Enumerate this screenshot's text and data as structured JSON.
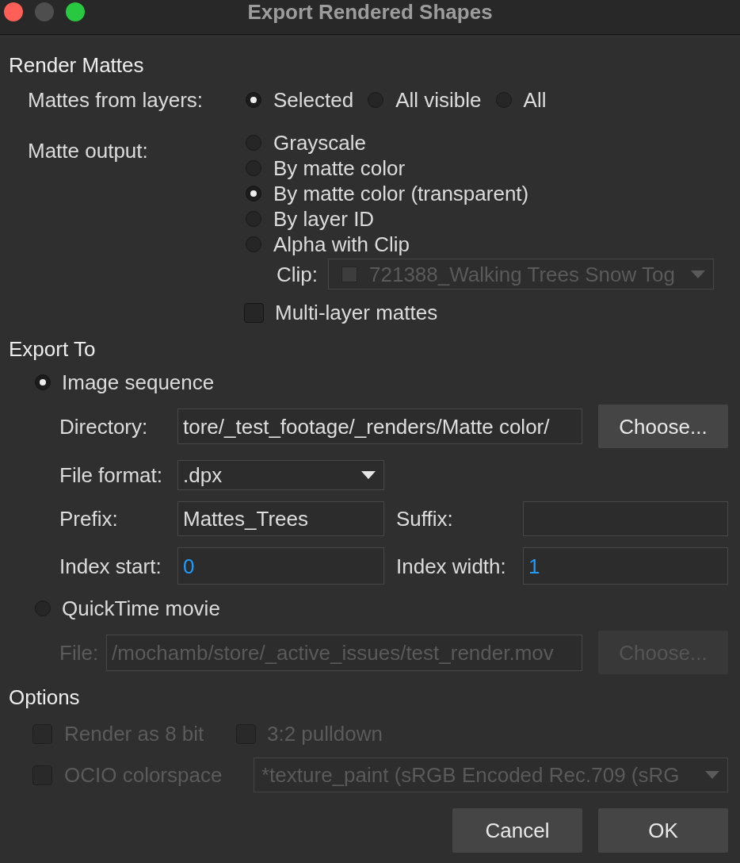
{
  "window": {
    "title": "Export Rendered Shapes",
    "controls": [
      {
        "kind": "close",
        "disabled": false
      },
      {
        "kind": "minimize",
        "disabled": true
      },
      {
        "kind": "zoom",
        "disabled": false
      }
    ]
  },
  "render_mattes": {
    "heading": "Render Mattes",
    "mattes_from_layers": {
      "label": "Mattes from layers:",
      "options": [
        {
          "label": "Selected",
          "selected": true
        },
        {
          "label": "All visible",
          "selected": false
        },
        {
          "label": "All",
          "selected": false
        }
      ]
    },
    "matte_output": {
      "label": "Matte output:",
      "options": [
        {
          "label": "Grayscale",
          "selected": false
        },
        {
          "label": "By matte color",
          "selected": false
        },
        {
          "label": "By matte color (transparent)",
          "selected": true
        },
        {
          "label": "By layer ID",
          "selected": false
        },
        {
          "label": "Alpha with Clip",
          "selected": false
        }
      ],
      "clip": {
        "label": "Clip:",
        "value": "721388_Walking Trees Snow Tog",
        "disabled": true
      }
    },
    "multi_layer_mattes": {
      "label": "Multi-layer mattes",
      "checked": false
    }
  },
  "export_to": {
    "heading": "Export To",
    "image_sequence": {
      "label": "Image sequence",
      "selected": true,
      "directory": {
        "label": "Directory:",
        "value": "tore/_test_footage/_renders/Matte color/",
        "button": "Choose..."
      },
      "file_format": {
        "label": "File format:",
        "value": ".dpx"
      },
      "prefix": {
        "label": "Prefix:",
        "value": "Mattes_Trees"
      },
      "suffix": {
        "label": "Suffix:"
      },
      "index_start": {
        "label": "Index start:",
        "value": "0"
      },
      "index_width": {
        "label": "Index width:",
        "value": "1"
      }
    },
    "quicktime_movie": {
      "label": "QuickTime movie",
      "selected": false,
      "file": {
        "label": "File:",
        "value": "/mochamb/store/_active_issues/test_render.mov",
        "button": "Choose...",
        "disabled": true
      }
    }
  },
  "options": {
    "heading": "Options",
    "render_8_bit": {
      "label": "Render as 8 bit",
      "checked": false,
      "disabled": true
    },
    "pulldown": {
      "label": "3:2 pulldown",
      "checked": false,
      "disabled": true
    },
    "ocio_colorspace": {
      "label": "OCIO colorspace",
      "checked": false,
      "disabled": true,
      "value": "*texture_paint (sRGB Encoded Rec.709 (sRG"
    }
  },
  "buttons": [
    "Cancel",
    "OK"
  ]
}
